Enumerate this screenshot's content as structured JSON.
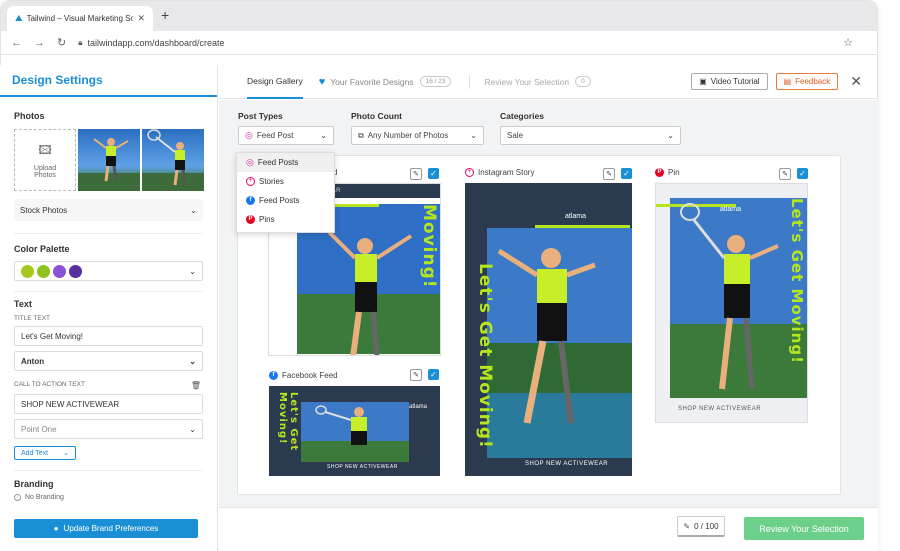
{
  "browser": {
    "tab_title": "Tailwind – Visual Marketing So",
    "url": "tailwindapp.com/dashboard/create"
  },
  "left_panel": {
    "title": "Design Settings",
    "photos_heading": "Photos",
    "upload_label": "Upload Photos",
    "stock_photos": "Stock Photos",
    "color_palette_heading": "Color Palette",
    "palette_colors": [
      "#a6c81e",
      "#8ec21f",
      "#8a52d6",
      "#5a2da0"
    ],
    "text_heading": "Text",
    "title_text_label": "TITLE TEXT",
    "title_text_value": "Let's Get Moving!",
    "title_font": "Anton",
    "cta_label": "CALL TO ACTION TEXT",
    "cta_value": "SHOP NEW ACTIVEWEAR",
    "cta_font": "Point One",
    "add_text": "Add Text",
    "branding_heading": "Branding",
    "no_branding": "No Branding",
    "update_brand": "Update Brand Preferences"
  },
  "top_nav": {
    "design_gallery": "Design Gallery",
    "favorites": "Your Favorite Designs",
    "favorites_count": "16 / 23",
    "review": "Review Your Selection",
    "review_count": "0",
    "video_tutorial": "Video Tutorial",
    "feedback": "Feedback"
  },
  "filters": {
    "post_types_label": "Post Types",
    "post_types_value": "Feed Post",
    "photo_count_label": "Photo Count",
    "photo_count_value": "Any Number of Photos",
    "categories_label": "Categories",
    "categories_value": "Sale"
  },
  "dropdown": {
    "items": [
      "Feed Posts",
      "Stories",
      "Feed Posts",
      "Pins"
    ]
  },
  "cards": {
    "instagram_feed_label": "d",
    "instagram_story_label": "Instagram Story",
    "pin_label": "Pin",
    "facebook_feed_label": "Facebook Feed",
    "headline": "Let's Get Moving!",
    "cta": "SHOP NEW ACTIVEWEAR",
    "brand": "atlama",
    "feed_corner": "WEAR"
  },
  "footer": {
    "counter": "0 / 100",
    "review_button": "Review Your Selection"
  },
  "colors": {
    "accent": "#1b8fd6",
    "feedback": "#e05a1c",
    "review": "#6dd08a",
    "neon": "#b5e61d",
    "dark_card": "#2b3a4e"
  }
}
